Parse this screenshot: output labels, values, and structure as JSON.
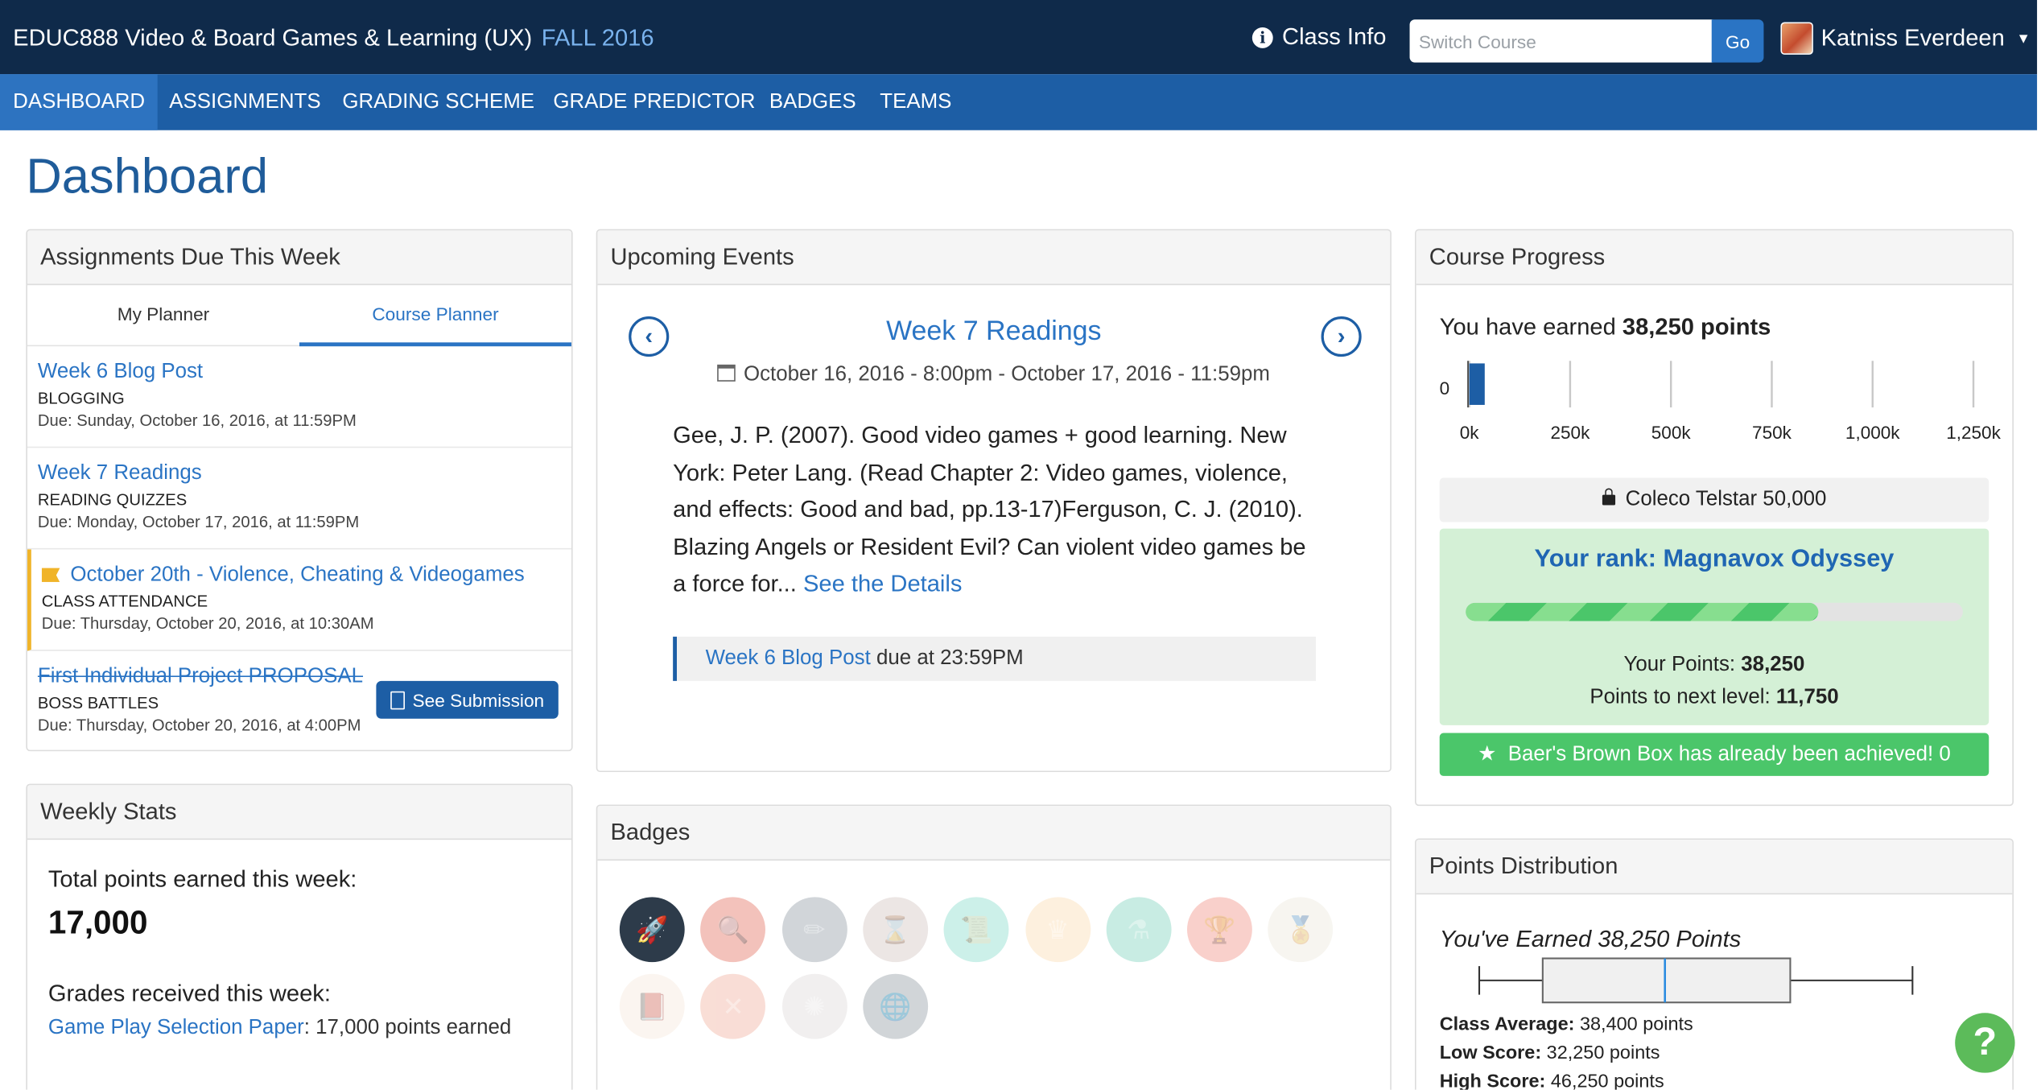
{
  "topbar": {
    "course_code": "EDUC888",
    "course_name": "Video & Board Games & Learning (UX)",
    "term": "FALL 2016",
    "class_info": "Class Info",
    "switch_placeholder": "Switch Course",
    "go": "Go",
    "user_name": "Katniss Everdeen"
  },
  "nav": [
    "DASHBOARD",
    "ASSIGNMENTS",
    "GRADING SCHEME",
    "GRADE PREDICTOR",
    "BADGES",
    "TEAMS"
  ],
  "page_title": "Dashboard",
  "assignments_panel": {
    "title": "Assignments Due This Week",
    "tabs": [
      "My Planner",
      "Course Planner"
    ],
    "items": [
      {
        "title": "Week 6 Blog Post",
        "category": "BLOGGING",
        "due": "Due: Sunday, October 16, 2016, at 11:59PM"
      },
      {
        "title": "Week 7 Readings",
        "category": "READING QUIZZES",
        "due": "Due: Monday, October 17, 2016, at 11:59PM"
      },
      {
        "title": "October 20th - Violence, Cheating & Videogames",
        "category": "CLASS ATTENDANCE",
        "due": "Due: Thursday, October 20, 2016, at 10:30AM"
      },
      {
        "title": "First Individual Project PROPOSAL",
        "category": "BOSS BATTLES",
        "due": "Due: Thursday, October 20, 2016, at 4:00PM"
      }
    ],
    "see_submission": "See Submission"
  },
  "events_panel": {
    "title": "Upcoming Events",
    "event_title": "Week 7 Readings",
    "event_date": "October 16, 2016 - 8:00pm - October 17, 2016 - 11:59pm",
    "description": "Gee, J. P. (2007). Good video games + good learning. New York: Peter Lang. (Read Chapter 2: Video games, violence, and effects: Good and bad, pp.13-17)Ferguson, C. J. (2010). Blazing Angels or Resident Evil? Can violent video games be a force for...",
    "details_link": "See the Details",
    "due_link": "Week 6 Blog Post",
    "due_text": " due at 23:59PM"
  },
  "badges_panel": {
    "title": "Badges",
    "badges": [
      {
        "icon": "rocket-icon",
        "color": "#2d3b4a",
        "earned": true
      },
      {
        "icon": "magnifier-icon",
        "color": "#f2b8b0",
        "earned": false
      },
      {
        "icon": "pencils-icon",
        "color": "#c9ced3",
        "earned": false
      },
      {
        "icon": "hourglass-icon",
        "color": "#e9e2e0",
        "earned": false
      },
      {
        "icon": "certificate-icon",
        "color": "#c4eee6",
        "earned": false
      },
      {
        "icon": "crown-icon",
        "color": "#fdeed9",
        "earned": false
      },
      {
        "icon": "flask-icon",
        "color": "#bfe9df",
        "earned": false
      },
      {
        "icon": "trophy-icon",
        "color": "#f8c8c3",
        "earned": false
      },
      {
        "icon": "medal-icon",
        "color": "#f6f4ee",
        "earned": false
      },
      {
        "icon": "book-icon",
        "color": "#fbf4ee",
        "earned": false
      },
      {
        "icon": "strategy-icon",
        "color": "#f8d8cf",
        "earned": false
      },
      {
        "icon": "sparkle-icon",
        "color": "#efeded",
        "earned": false
      },
      {
        "icon": "globe-icon",
        "color": "#c9ced2",
        "earned": false
      }
    ]
  },
  "progress_panel": {
    "title": "Course Progress",
    "earned_prefix": "You have earned ",
    "earned_value": "38,250 points",
    "axis_ticks": [
      "0k",
      "250k",
      "500k",
      "750k",
      "1,000k",
      "1,250k"
    ],
    "axis_zero": "0",
    "current_points": 38250,
    "axis_max": 1250000,
    "next_level": "Coleco Telstar 50,000",
    "rank_title": "Your rank: Magnavox Odyssey",
    "rank_progress_fraction": 0.71,
    "your_points_label": "Your Points: ",
    "your_points_value": "38,250",
    "next_level_label": "Points to next level: ",
    "next_level_value": "11,750",
    "achievement": "Baer's Brown Box has already been achieved! 0"
  },
  "weekly_panel": {
    "title": "Weekly Stats",
    "total_label": "Total points earned this week:",
    "total_value": "17,000",
    "grades_label": "Grades received this week:",
    "grade_link": "Game Play Selection Paper",
    "grade_text": ": 17,000 points earned"
  },
  "distribution_panel": {
    "title": "Points Distribution",
    "earned_label": "You've Earned 38,250 Points",
    "avg_label": "Class Average:",
    "avg_value": " 38,400 points",
    "low_label": "Low Score:",
    "low_value": " 32,250 points",
    "high_label": "High Score:",
    "high_value": " 46,250 points",
    "box_stats": {
      "min": 32250,
      "q1": 34300,
      "median": 38400,
      "q3": 42300,
      "max": 46250,
      "you": 38250
    }
  },
  "colors": {
    "topbar": "#0f2a4a",
    "navbar": "#1d5ea5",
    "link": "#2a74c4",
    "success": "#4bc66a"
  }
}
